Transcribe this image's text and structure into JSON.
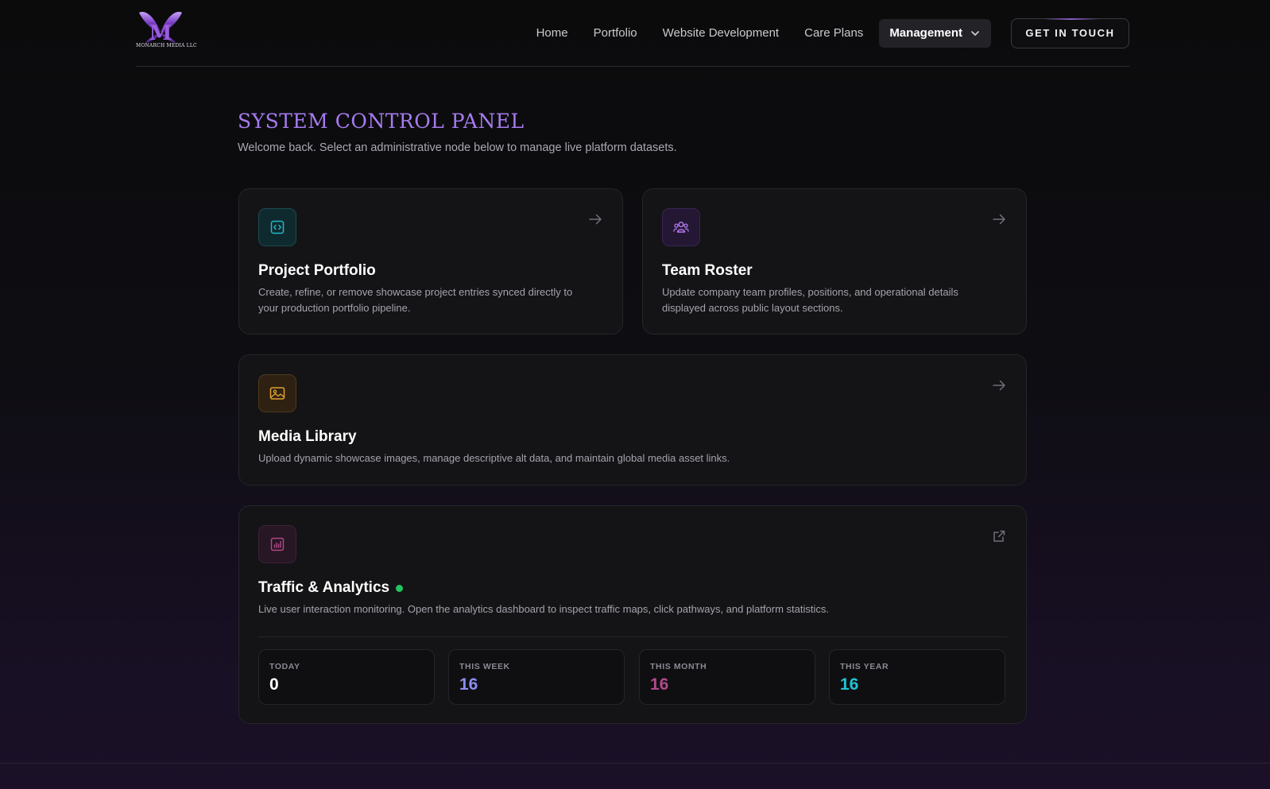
{
  "brand": {
    "logo_text": "MONARCH MEDIA LLC",
    "accent": "#a67bf0"
  },
  "nav": {
    "links": [
      "Home",
      "Portfolio",
      "Website Development",
      "Care Plans"
    ],
    "dropdown_label": "Management",
    "cta_label": "GET IN TOUCH"
  },
  "page": {
    "title": "SYSTEM CONTROL PANEL",
    "subtitle": "Welcome back. Select an administrative node below to manage live platform datasets."
  },
  "cards": {
    "portfolio": {
      "title": "Project Portfolio",
      "description": "Create, refine, or remove showcase project entries synced directly to your production portfolio pipeline.",
      "icon": "code-icon",
      "color": "#22b8c9"
    },
    "team": {
      "title": "Team Roster",
      "description": "Update company team profiles, positions, and operational details displayed across public layout sections.",
      "icon": "users-icon",
      "color": "#b57cf5"
    },
    "media": {
      "title": "Media Library",
      "description": "Upload dynamic showcase images, manage descriptive alt data, and maintain global media asset links.",
      "icon": "image-icon",
      "color": "#e0a030"
    },
    "analytics": {
      "title": "Traffic & Analytics",
      "description": "Live user interaction monitoring. Open the analytics dashboard to inspect traffic maps, click pathways, and platform statistics.",
      "icon": "bar-chart-icon",
      "color": "#b04a8a",
      "live_color": "#22c55e",
      "stats": [
        {
          "label": "TODAY",
          "value": "0",
          "color": "#ffffff"
        },
        {
          "label": "THIS WEEK",
          "value": "16",
          "color": "#8b8df5"
        },
        {
          "label": "THIS MONTH",
          "value": "16",
          "color": "#b04a8a"
        },
        {
          "label": "THIS YEAR",
          "value": "16",
          "color": "#22c3d6"
        }
      ]
    }
  }
}
